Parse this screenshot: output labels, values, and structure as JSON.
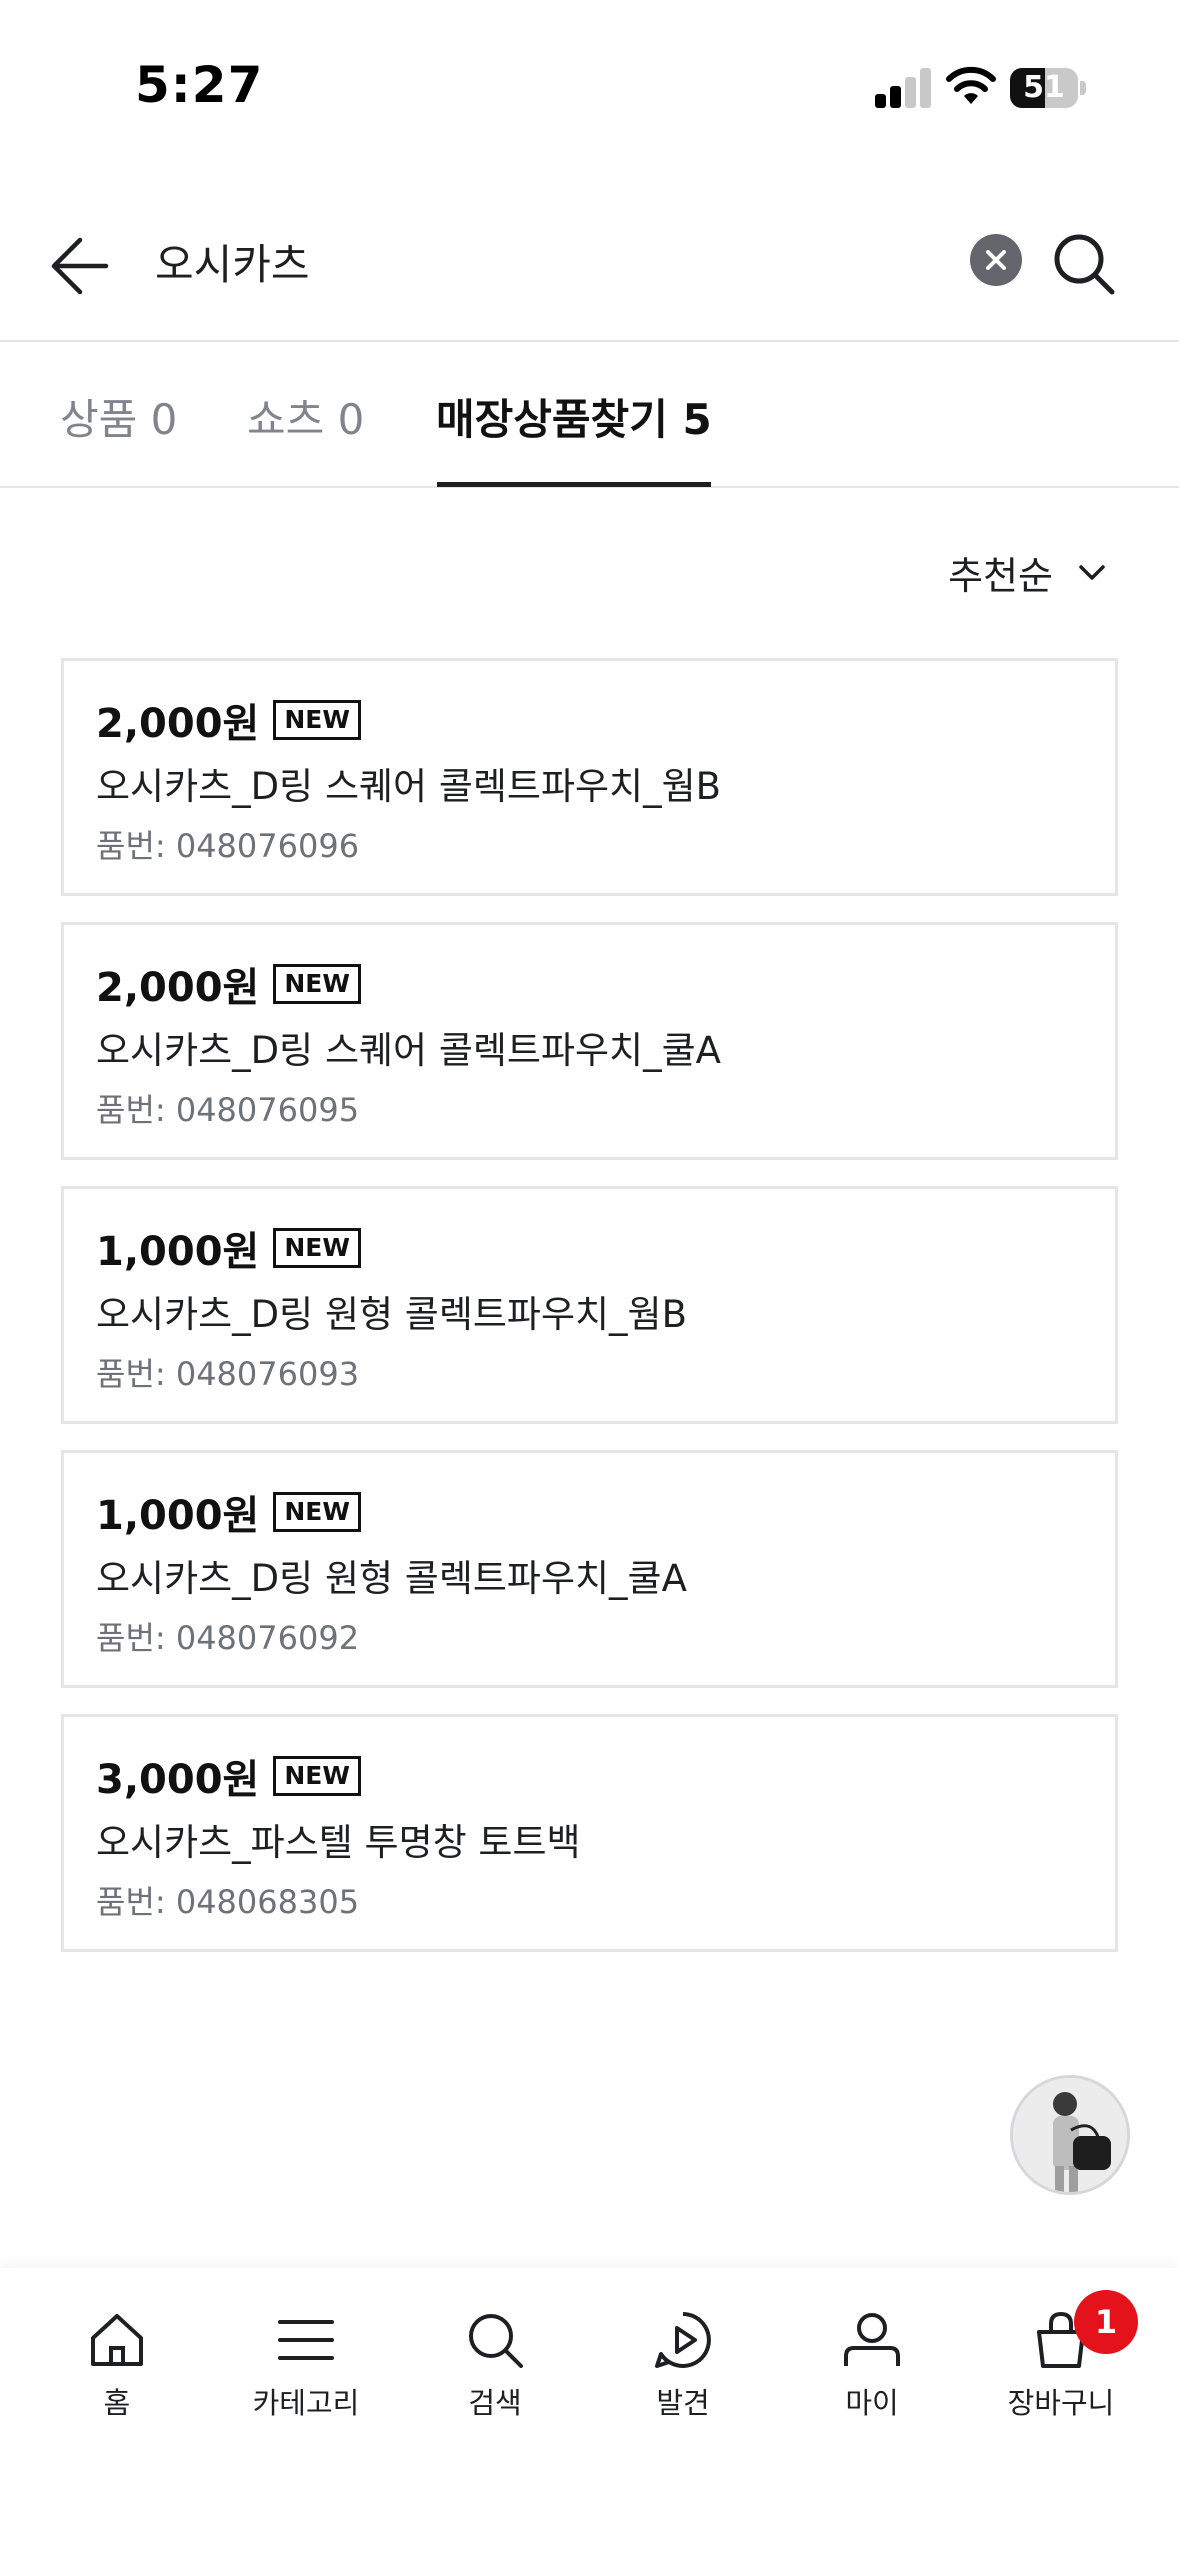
{
  "status_bar": {
    "time": "5:27",
    "battery_level": "51",
    "icons": [
      "signal-icon",
      "wifi-icon",
      "battery-icon"
    ]
  },
  "search": {
    "query": "오시카츠",
    "icons": [
      "back-arrow-icon",
      "clear-icon",
      "search-icon"
    ]
  },
  "tabs": [
    {
      "label": "상품 0",
      "active": false
    },
    {
      "label": "쇼츠 0",
      "active": false
    },
    {
      "label": "매장상품찾기 5",
      "active": true
    }
  ],
  "sort": {
    "label": "추천순",
    "icon": "chevron-down-icon"
  },
  "products": [
    {
      "price": "2,000원",
      "badge": "NEW",
      "name": "오시카츠_D링 스퀘어 콜렉트파우치_웜B",
      "code": "품번: 048076096"
    },
    {
      "price": "2,000원",
      "badge": "NEW",
      "name": "오시카츠_D링 스퀘어 콜렉트파우치_쿨A",
      "code": "품번: 048076095"
    },
    {
      "price": "1,000원",
      "badge": "NEW",
      "name": "오시카츠_D링 원형 콜렉트파우치_웜B",
      "code": "품번: 048076093"
    },
    {
      "price": "1,000원",
      "badge": "NEW",
      "name": "오시카츠_D링 원형 콜렉트파우치_쿨A",
      "code": "품번: 048076092"
    },
    {
      "price": "3,000원",
      "badge": "NEW",
      "name": "오시카츠_파스텔 투명창 토트백",
      "code": "품번: 048068305"
    }
  ],
  "bottom_nav": [
    {
      "label": "홈",
      "icon": "home-icon"
    },
    {
      "label": "카테고리",
      "icon": "menu-icon"
    },
    {
      "label": "검색",
      "icon": "search-icon"
    },
    {
      "label": "발견",
      "icon": "play-icon"
    },
    {
      "label": "마이",
      "icon": "user-icon"
    },
    {
      "label": "장바구니",
      "icon": "bag-icon",
      "badge": "1"
    }
  ],
  "colors": {
    "accent_badge": "#e3121b",
    "text_primary": "#1d1f22",
    "text_secondary": "#80858d",
    "border": "#e4e5e7"
  }
}
